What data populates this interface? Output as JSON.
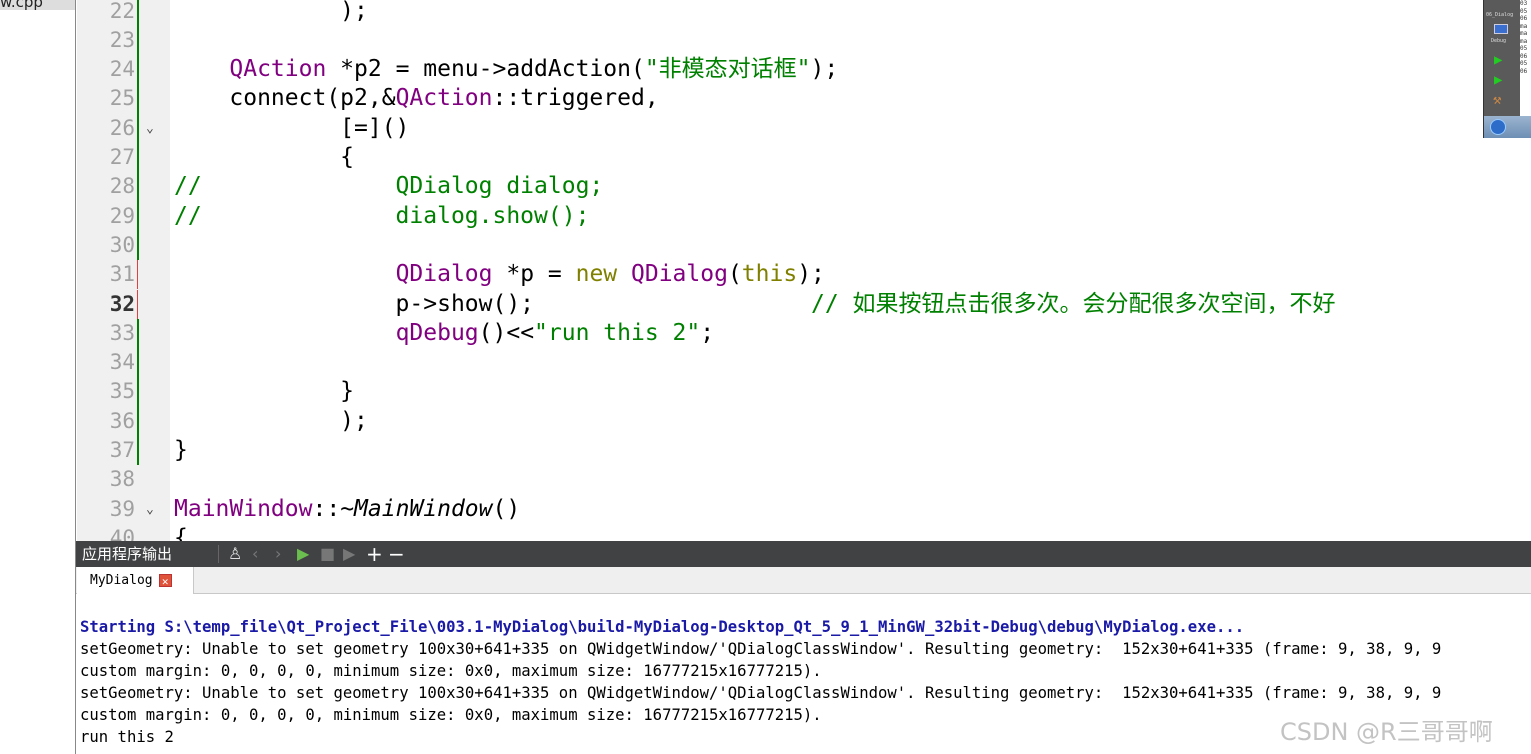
{
  "sidebar": {
    "file": "w.cpp"
  },
  "editor": {
    "first_line": 22,
    "current_line": 32,
    "lines": [
      {
        "n": 22,
        "tokens": [
          [
            "            );",
            ""
          ]
        ]
      },
      {
        "n": 23,
        "tokens": []
      },
      {
        "n": 24,
        "tokens": [
          [
            "    ",
            ""
          ],
          [
            "QAction",
            "kw"
          ],
          [
            " *p2 = menu->addAction(",
            ""
          ],
          [
            "\"非模态对话框\"",
            "str"
          ],
          [
            ");",
            ""
          ]
        ]
      },
      {
        "n": 25,
        "tokens": [
          [
            "    connect(p2,&",
            ""
          ],
          [
            "QAction",
            "kw"
          ],
          [
            "::triggered,",
            ""
          ]
        ]
      },
      {
        "n": 26,
        "fold": true,
        "tokens": [
          [
            "            [=]()",
            ""
          ]
        ]
      },
      {
        "n": 27,
        "tokens": [
          [
            "            {",
            ""
          ]
        ]
      },
      {
        "n": 28,
        "tokens": [
          [
            "//              QDialog dialog;",
            "cm"
          ]
        ]
      },
      {
        "n": 29,
        "tokens": [
          [
            "//              dialog.show();",
            "cm"
          ]
        ]
      },
      {
        "n": 30,
        "tokens": []
      },
      {
        "n": 31,
        "tokens": [
          [
            "                ",
            ""
          ],
          [
            "QDialog",
            "kw"
          ],
          [
            " *p = ",
            ""
          ],
          [
            "new",
            "ol"
          ],
          [
            " ",
            ""
          ],
          [
            "QDialog",
            "kw"
          ],
          [
            "(",
            ""
          ],
          [
            "this",
            "ol"
          ],
          [
            ");",
            ""
          ]
        ]
      },
      {
        "n": 32,
        "tokens": [
          [
            "                p->show();                    ",
            ""
          ],
          [
            "// 如果按钮点击很多次。会分配很多次空间，不好",
            "cm"
          ]
        ]
      },
      {
        "n": 33,
        "tokens": [
          [
            "                ",
            ""
          ],
          [
            "qDebug",
            "kw"
          ],
          [
            "()<<",
            ""
          ],
          [
            "\"run this 2\"",
            "str"
          ],
          [
            ";",
            ""
          ]
        ]
      },
      {
        "n": 34,
        "tokens": []
      },
      {
        "n": 35,
        "tokens": [
          [
            "            }",
            ""
          ]
        ]
      },
      {
        "n": 36,
        "tokens": [
          [
            "            );",
            ""
          ]
        ]
      },
      {
        "n": 37,
        "tokens": [
          [
            "}",
            ""
          ]
        ]
      },
      {
        "n": 38,
        "tokens": []
      },
      {
        "n": 39,
        "fold": true,
        "tokens": [
          [
            "MainWindow",
            "kw"
          ],
          [
            "::",
            ""
          ],
          [
            "~MainWindow",
            "it"
          ],
          [
            "()",
            ""
          ]
        ]
      },
      {
        "n": 40,
        "tokens": [
          [
            "{",
            ""
          ]
        ]
      }
    ]
  },
  "panel": {
    "title": "应用程序输出",
    "tab": "MyDialog",
    "icons": [
      "clear-icon",
      "prev-icon",
      "next-icon",
      "run-icon",
      "stop-icon",
      "attach-icon",
      "zoom-in-icon",
      "zoom-out-icon"
    ]
  },
  "output": {
    "lines": [
      {
        "text": "Starting S:\\temp_file\\Qt_Project_File\\003.1-MyDialog\\build-MyDialog-Desktop_Qt_5_9_1_MinGW_32bit-Debug\\debug\\MyDialog.exe...",
        "cls": "start"
      },
      {
        "text": "setGeometry: Unable to set geometry 100x30+641+335 on QWidgetWindow/'QDialogClassWindow'. Resulting geometry:  152x30+641+335 (frame: 9, 38, 9, 9",
        "cls": ""
      },
      {
        "text": "custom margin: 0, 0, 0, 0, minimum size: 0x0, maximum size: 16777215x16777215).",
        "cls": ""
      },
      {
        "text": "setGeometry: Unable to set geometry 100x30+641+335 on QWidgetWindow/'QDialogClassWindow'. Resulting geometry:  152x30+641+335 (frame: 9, 38, 9, 9",
        "cls": ""
      },
      {
        "text": "custom margin: 0, 0, 0, 0, minimum size: 0x0, maximum size: 16777215x16777215).",
        "cls": ""
      },
      {
        "text": "run this 2",
        "cls": ""
      }
    ]
  },
  "mini": {
    "project": "06_Dialog",
    "mode": "Debug",
    "list": [
      "03",
      "05",
      "06",
      "ma",
      "ma",
      "ma",
      "05",
      "06",
      "05",
      "06"
    ]
  },
  "watermark": "CSDN @R三哥哥啊"
}
